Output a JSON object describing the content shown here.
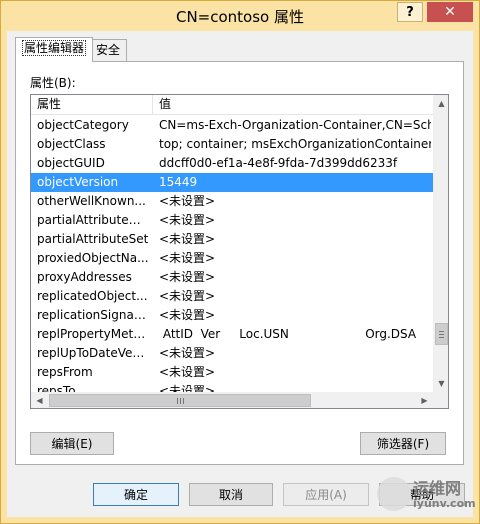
{
  "window": {
    "title": "CN=contoso 属性",
    "help_label": "?",
    "close_label": "✕"
  },
  "tabs": [
    {
      "label": "属性编辑器",
      "active": true
    },
    {
      "label": "安全",
      "active": false
    }
  ],
  "attributes_label": "属性(B):",
  "columns": {
    "name": "属性",
    "value": "值"
  },
  "rows": [
    {
      "name": "objectCategory",
      "value": "CN=ms-Exch-Organization-Container,CN=Sche"
    },
    {
      "name": "objectClass",
      "value": "top; container; msExchOrganizationContainer"
    },
    {
      "name": "objectGUID",
      "value": "ddcff0d0-ef1a-4e8f-9fda-7d399dd6233f"
    },
    {
      "name": "objectVersion",
      "value": "15449"
    },
    {
      "name": "otherWellKnown...",
      "value": "<未设置>"
    },
    {
      "name": "partialAttributeDe...",
      "value": "<未设置>"
    },
    {
      "name": "partialAttributeSet",
      "value": "<未设置>"
    },
    {
      "name": "proxiedObjectNa...",
      "value": "<未设置>"
    },
    {
      "name": "proxyAddresses",
      "value": "<未设置>"
    },
    {
      "name": "replicatedObject...",
      "value": "<未设置>"
    },
    {
      "name": "replicationSignat...",
      "value": "<未设置>"
    },
    {
      "name": "replPropertyMeta...",
      "value": " AttID  Ver     Loc.USN                    Org.DSA"
    },
    {
      "name": "replUpToDateVec...",
      "value": "<未设置>"
    },
    {
      "name": "repsFrom",
      "value": "<未设置>"
    },
    {
      "name": "repsTo",
      "value": "<未设置>"
    }
  ],
  "selected_row": 3,
  "buttons": {
    "edit": "编辑(E)",
    "filter": "筛选器(F)",
    "ok": "确定",
    "cancel": "取消",
    "apply": "应用(A)",
    "help": "帮助"
  },
  "watermark": {
    "line1": "运维网",
    "line2": "iyunv.com"
  },
  "colors": {
    "selection": "#3399ff",
    "title_bar": "#fbe2a5",
    "close_button": "#c75050"
  }
}
